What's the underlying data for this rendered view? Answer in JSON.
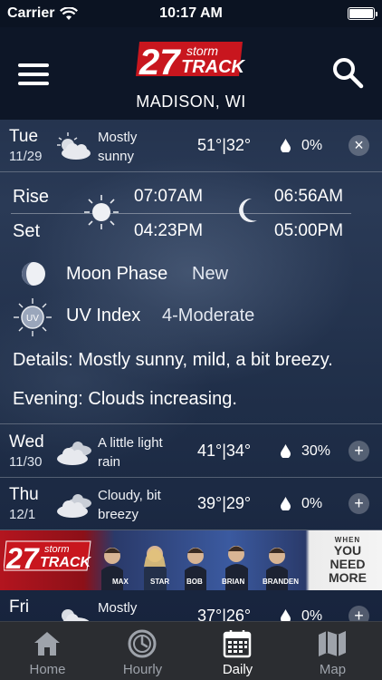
{
  "status_bar": {
    "carrier": "Carrier",
    "time": "10:17 AM"
  },
  "header": {
    "logo_number": "27",
    "logo_storm": "storm",
    "logo_track": "TRACK",
    "city": "MADISON, WI"
  },
  "days": [
    {
      "day": "Tue",
      "date": "11/29",
      "condition": [
        "Mostly",
        "sunny"
      ],
      "temps": "51°|32°",
      "precip": "0%",
      "toggle": "×"
    },
    {
      "day": "Wed",
      "date": "11/30",
      "condition": [
        "A little light",
        "rain"
      ],
      "temps": "41°|34°",
      "precip": "30%",
      "toggle": "+"
    },
    {
      "day": "Thu",
      "date": "12/1",
      "condition": [
        "Cloudy, bit",
        "breezy"
      ],
      "temps": "39°|29°",
      "precip": "0%",
      "toggle": "+"
    },
    {
      "day": "Fri",
      "date": "",
      "condition": [
        "Mostly",
        ""
      ],
      "temps": "37°|26°",
      "precip": "0%",
      "toggle": "+"
    }
  ],
  "details": {
    "rise_label": "Rise",
    "set_label": "Set",
    "sunrise": "07:07AM",
    "sunset": "04:23PM",
    "moonrise": "06:56AM",
    "moonset": "05:00PM",
    "moon_phase_label": "Moon Phase",
    "moon_phase_value": "New",
    "uv_label": "UV Index",
    "uv_value": "4-Moderate",
    "uv_icon_text": "UV",
    "details_text": "Details: Mostly sunny, mild, a bit breezy.",
    "evening_text": "Evening: Clouds increasing."
  },
  "ad": {
    "logo_number": "27",
    "logo_storm": "storm",
    "logo_track": "TRACK",
    "names": [
      "MAX",
      "STAR",
      "BOB",
      "BRIAN",
      "BRANDEN"
    ],
    "cta_line1": "WHEN",
    "cta_line2": "YOU",
    "cta_line3": "NEED",
    "cta_line4": "MORE"
  },
  "tabs": [
    {
      "label": "Home",
      "icon": "home-icon",
      "active": false
    },
    {
      "label": "Hourly",
      "icon": "clock-icon",
      "active": false
    },
    {
      "label": "Daily",
      "icon": "calendar-icon",
      "active": true
    },
    {
      "label": "Map",
      "icon": "map-icon",
      "active": false
    }
  ],
  "colors": {
    "brand_red": "#c8161e",
    "tab_active": "#ffffff",
    "tab_inactive": "#9ea3ab"
  }
}
